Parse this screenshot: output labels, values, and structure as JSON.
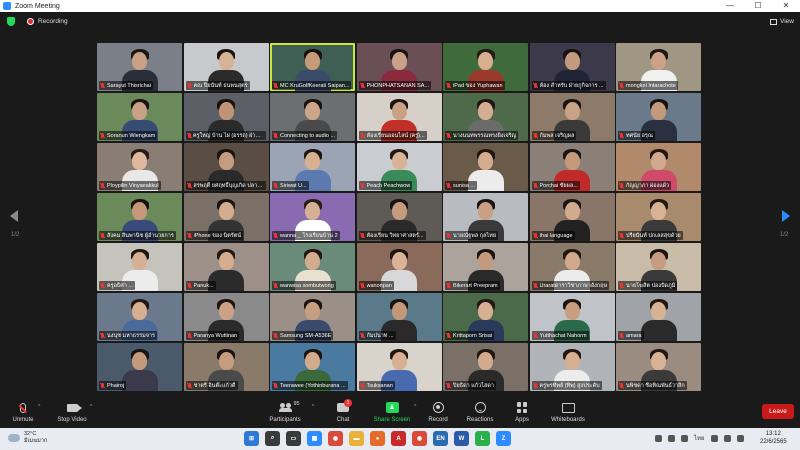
{
  "window": {
    "title": "Zoom Meeting",
    "minimize": "—",
    "maximize": "☐",
    "close": "✕"
  },
  "topbar": {
    "recording_label": "Recording",
    "view_label": "View"
  },
  "gallery": {
    "page_left": "1/2",
    "page_right": "1/2",
    "tiles": [
      {
        "name": "Sarayut Thisrichai",
        "bg": "#7a7f88",
        "skin": "#c9a184",
        "shirt": "#2a2d3a",
        "hair": "#1c1410"
      },
      {
        "name": "คณ ปิยนันท์ ธนพนสุตร",
        "bg": "#c7c9cc",
        "skin": "#d7b395",
        "shirt": "#2b2b2b",
        "hair": "#1a1410"
      },
      {
        "name": "MC KruGolfKeerati Saipan...",
        "bg": "#3f5f54",
        "skin": "#c79b7a",
        "shirt": "#3a4c6a",
        "hair": "#151210",
        "active": true
      },
      {
        "name": "PHONPHATSANAN SA...",
        "bg": "#6a4f56",
        "skin": "#c9a08a",
        "shirt": "#8a2a3c",
        "hair": "#1b1311"
      },
      {
        "name": "iPad ของ Yuphawan",
        "bg": "#3f6a3b",
        "skin": "#d8ae90",
        "shirt": "#9a3a2a",
        "hair": "#231812"
      },
      {
        "name": "ห้อง สำหรับ ฝ่ายกูกิจการ ...",
        "bg": "#3c3a4a",
        "skin": "#c49a7e",
        "shirt": "#202434",
        "hair": "#161212"
      },
      {
        "name": "mongkol Intarachote",
        "bg": "#a09684",
        "skin": "#cba187",
        "shirt": "#f0f0f0",
        "hair": "#1d1612"
      },
      {
        "name": "Soranun Wiengkam",
        "bg": "#6b8a5c",
        "skin": "#c8a286",
        "shirt": "#364c74",
        "hair": "#1b1410"
      },
      {
        "name": "ครูใหญ่ บ้าน ไผ่ (อรรถ) ฝ่ายบริหาร",
        "bg": "#5c6066",
        "skin": "#c19478",
        "shirt": "#2a2a2a",
        "hair": "#171210"
      },
      {
        "name": "Connecting to audio ...",
        "bg": "#6b6f72",
        "skin": "#cda68a",
        "shirt": "#4a4a4a",
        "hair": "#1a1410"
      },
      {
        "name": "ห้องเรียนออนไลน์ (ครู)...",
        "bg": "#d6d0c8",
        "skin": "#c9a285",
        "shirt": "#c03028",
        "hair": "#1b1412"
      },
      {
        "name": "นางนนทพรรณทรงยิ่งเจริญ",
        "bg": "#4f6a4a",
        "skin": "#d4ad92",
        "shirt": "#6b6b6b",
        "hair": "#1f1612"
      },
      {
        "name": "กัมพล เจริญผล",
        "bg": "#8e7a68",
        "skin": "#caa286",
        "shirt": "#3a3a3a",
        "hair": "#1a1410"
      },
      {
        "name": "ทศนัย อรุณ",
        "bg": "#6a7a8a",
        "skin": "#c39a7c",
        "shirt": "#2a3040",
        "hair": "#181310"
      },
      {
        "name": "Ploypilin Vinyaeakkul",
        "bg": "#8a7e74",
        "skin": "#dcb89c",
        "shirt": "#e8e8e8",
        "hair": "#251a14"
      },
      {
        "name": "สรพฤติ์ ยศฤทธิ์บุญเกิด ปลาย...",
        "bg": "#5a4e44",
        "skin": "#c49c80",
        "shirt": "#2a2a2a",
        "hair": "#1a1410"
      },
      {
        "name": "Siriwat U...",
        "bg": "#9aa4b4",
        "skin": "#d7b092",
        "shirt": "#5a7ab0",
        "hair": "#1c1512"
      },
      {
        "name": "Peach Peachwow",
        "bg": "#c9ccd0",
        "skin": "#d9b396",
        "shirt": "#3a8a5a",
        "hair": "#241914"
      },
      {
        "name": "sunisa ...",
        "bg": "#6a5a4a",
        "skin": "#d4ac8e",
        "shirt": "#ececec",
        "hair": "#20160f"
      },
      {
        "name": "Porchai ชัยผล...",
        "bg": "#8a8078",
        "skin": "#c59a7c",
        "shirt": "#c02a2a",
        "hair": "#1a1310"
      },
      {
        "name": "กัญญาภา ผ่องแผ้ว",
        "bg": "#b08a6a",
        "skin": "#d1a98c",
        "shirt": "#d04a6a",
        "hair": "#21170f"
      },
      {
        "name": "สังคม สินพานิช ผู้อำนวยการ",
        "bg": "#6a8a5a",
        "skin": "#c49878",
        "shirt": "#3a4a7a",
        "hair": "#181310"
      },
      {
        "name": "iPhone ของ นิตรัตน์",
        "bg": "#7a7068",
        "skin": "#d3ad90",
        "shirt": "#333333",
        "hair": "#1d1410"
      },
      {
        "name": "wanna _ โรงเรียนบ้าน 2",
        "bg": "#8a6ab0",
        "skin": "#d6b094",
        "shirt": "#ffffff",
        "hair": "#2a1d16"
      },
      {
        "name": "ห้องเรียน วิทยาศาสตร์...",
        "bg": "#5e5a56",
        "skin": "#c59c80",
        "shirt": "#2a2a2a",
        "hair": "#1a1310"
      },
      {
        "name": "นายณัฐพล กุลไทย",
        "bg": "#b8bcc0",
        "skin": "#caa084",
        "shirt": "#3a3a3a",
        "hair": "#1a1410"
      },
      {
        "name": "thai language",
        "bg": "#8a7668",
        "skin": "#d2aa8c",
        "shirt": "#222222",
        "hair": "#1e1512"
      },
      {
        "name": "ปรียนันท์ ปกเลสสุขด้วย",
        "bg": "#a88a6c",
        "skin": "#d8b294",
        "shirt": "#3a3a3a",
        "hair": "#231813"
      },
      {
        "name": "ครูอธิศา ...",
        "bg": "#c6c2bc",
        "skin": "#d6b094",
        "shirt": "#ececec",
        "hair": "#21170f"
      },
      {
        "name": "Panuk...",
        "bg": "#9c9088",
        "skin": "#d5ad90",
        "shirt": "#2b2b2b",
        "hair": "#231812"
      },
      {
        "name": "wanwisa sombutwong",
        "bg": "#6a8a7a",
        "skin": "#d3ab8e",
        "shirt": "#e8e0d0",
        "hair": "#22170f"
      },
      {
        "name": "wanonpan",
        "bg": "#8a6a5a",
        "skin": "#d9b498",
        "shirt": "#d8d8d8",
        "hair": "#1d1410"
      },
      {
        "name": "Bikerart Preepram",
        "bg": "#aca49c",
        "skin": "#c49a7e",
        "shirt": "#2a2a2a",
        "hair": "#181310"
      },
      {
        "name": "Uraratดาราวิชาภาษาอังกฤษ",
        "bg": "#8a7a6a",
        "skin": "#d1a98c",
        "shirt": "#ececec",
        "hair": "#21170f"
      },
      {
        "name": "นายโฆสิต ปองปัดภูมิ",
        "bg": "#c8bca8",
        "skin": "#c69c80",
        "shirt": "#3a3a3a",
        "hair": "#1a1310"
      },
      {
        "name": "นงนุช มหาธรรมจาร",
        "bg": "#6a7a8c",
        "skin": "#d6ae90",
        "shirt": "#4a6a9a",
        "hair": "#221710"
      },
      {
        "name": "Paranya Wuttinan",
        "bg": "#8a8a8a",
        "skin": "#cba286",
        "shirt": "#2a2a2a",
        "hair": "#1b1410"
      },
      {
        "name": "Samsung SM-A536E",
        "bg": "#9a9088",
        "skin": "#c69e82",
        "shirt": "#3a4a6a",
        "hair": "#191310"
      },
      {
        "name": "กัมปนาท ...",
        "bg": "#5a7a8a",
        "skin": "#c29878",
        "shirt": "#2a2a2a",
        "hair": "#181310"
      },
      {
        "name": "Krittaporn Srisai",
        "bg": "#4a6a4a",
        "skin": "#d7b094",
        "shirt": "#2a3a5a",
        "hair": "#241812"
      },
      {
        "name": "Yutthachat Nahorm",
        "bg": "#c0c4c8",
        "skin": "#c89e80",
        "shirt": "#2a6a4a",
        "hair": "#1a1410"
      },
      {
        "name": "amara",
        "bg": "#a0a4a8",
        "skin": "#d8b294",
        "shirt": "#2a2a2a",
        "hair": "#22170f"
      },
      {
        "name": "Phairoj",
        "bg": "#4a5a6a",
        "skin": "#c49a7c",
        "shirt": "#3a3a4a",
        "hair": "#181310"
      },
      {
        "name": "ชาตรี อินต๊ะแก้วดี",
        "bg": "#8a7a6a",
        "skin": "#c69c7e",
        "shirt": "#4a4a4a",
        "hair": "#1a1410"
      },
      {
        "name": "Teerawee (Yothinburana ...",
        "bg": "#4a7aa0",
        "skin": "#d2aa8c",
        "shirt": "#3a6a3a",
        "hair": "#1f1611"
      },
      {
        "name": "Tsuksanan",
        "bg": "#d8d4cc",
        "skin": "#d7b094",
        "shirt": "#4a6ab0",
        "hair": "#23180f"
      },
      {
        "name": "ปิยธิดา แก้วไสดา",
        "bg": "#7a7068",
        "skin": "#d2aa8c",
        "shirt": "#2a2a2a",
        "hair": "#21170f"
      },
      {
        "name": "ครูพรทิพย์ (ทิพ) สูงประดับ",
        "bg": "#b0b4b8",
        "skin": "#d6ae90",
        "shirt": "#ececec",
        "hair": "#22170f"
      },
      {
        "name": "นพิชดา ชื่อทิณพันธ์วาสิก",
        "bg": "#9a8c80",
        "skin": "#d8b296",
        "shirt": "#3a3a3a",
        "hair": "#241912"
      }
    ]
  },
  "toolbar": {
    "unmute": "Unmute",
    "stop_video": "Stop Video",
    "participants": "Participants",
    "participants_count": "95",
    "chat": "Chat",
    "chat_badge": "1",
    "share_screen": "Share Screen",
    "record": "Record",
    "reactions": "Reactions",
    "apps": "Apps",
    "whiteboards": "Whiteboards",
    "leave": "Leave",
    "caret": "^"
  },
  "taskbar": {
    "temperature": "32°C",
    "weather_desc": "มีเมฆมาก",
    "apps": [
      {
        "icon": "windows-icon",
        "color": "#2d7ad6",
        "label": "⊞"
      },
      {
        "icon": "search-icon",
        "color": "#3a3a3a",
        "label": "⌕"
      },
      {
        "icon": "task-view-icon",
        "color": "#3a3a3a",
        "label": "▭"
      },
      {
        "icon": "widgets-icon",
        "color": "#2d8cff",
        "label": "▦"
      },
      {
        "icon": "chrome-icon",
        "color": "#d84a3a",
        "label": "◉"
      },
      {
        "icon": "explorer-icon",
        "color": "#e8b23a",
        "label": "▬"
      },
      {
        "icon": "firefox-icon",
        "color": "#e86a2a",
        "label": "●"
      },
      {
        "icon": "pdf-icon",
        "color": "#c82a2a",
        "label": "A"
      },
      {
        "icon": "chrome-alt-icon",
        "color": "#d84a3a",
        "label": "◉"
      },
      {
        "icon": "en-icon",
        "color": "#2a6ab0",
        "label": "EN"
      },
      {
        "icon": "word-icon",
        "color": "#2a5aa8",
        "label": "W"
      },
      {
        "icon": "line-icon",
        "color": "#2ab04a",
        "label": "L"
      },
      {
        "icon": "zoom-icon",
        "color": "#2d8cff",
        "label": "Z"
      }
    ],
    "tray_lang": "ไทย",
    "time": "13:12",
    "date": "22/6/2565"
  },
  "colors": {
    "accent": "#2d8cff",
    "share_green": "#23d959",
    "leave_red": "#c71b1b",
    "active_speaker": "#c8e63c"
  }
}
